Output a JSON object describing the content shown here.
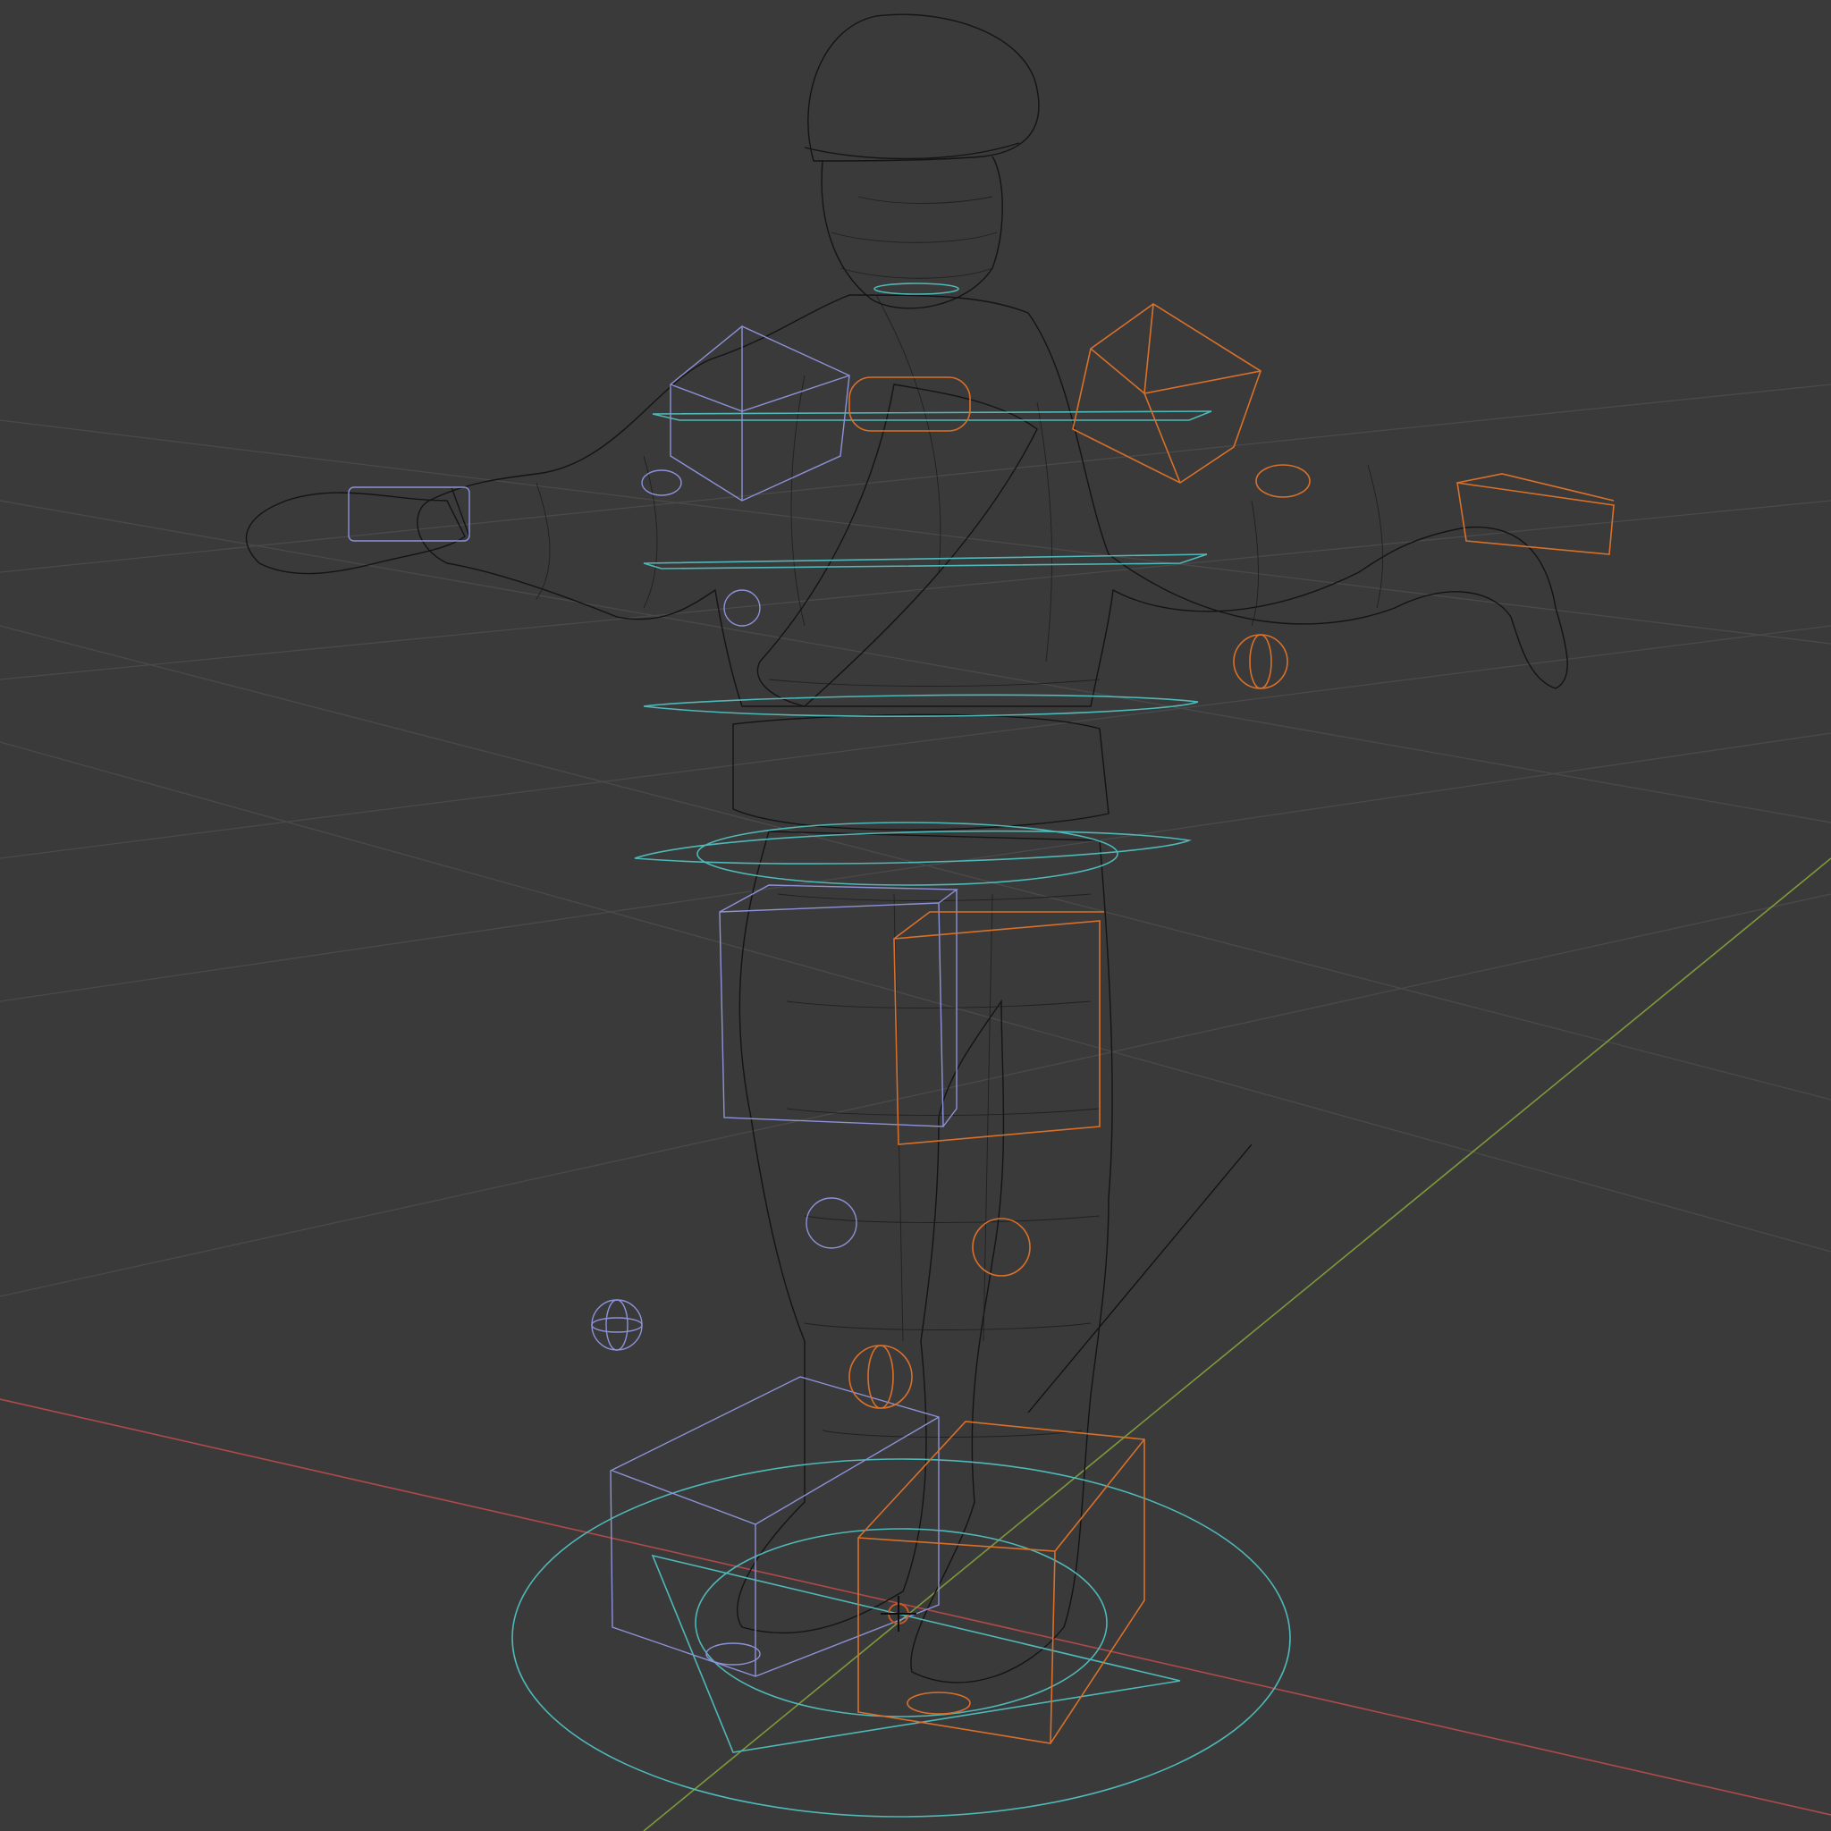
{
  "viewport": {
    "background": "#3a3a3a",
    "grid_color": "#4a4a4a",
    "axis_x_color": "#b04a4a",
    "axis_y_color": "#7d9a3a",
    "mesh_color": "#141414",
    "controls": {
      "cyan": "#4fb8b8",
      "blue_left": "#8c92d8",
      "orange_right": "#d9702a"
    },
    "icons": [
      "3d-cursor-icon"
    ]
  }
}
